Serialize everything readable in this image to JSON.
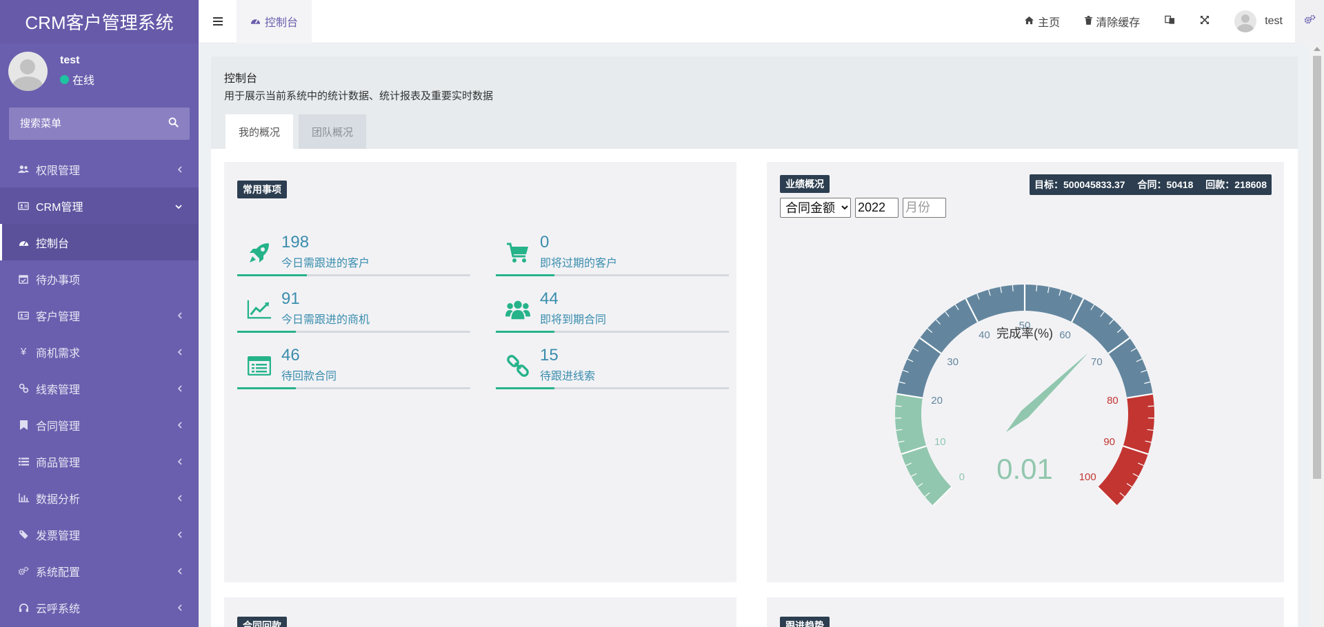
{
  "app": {
    "title": "CRM客户管理系统"
  },
  "user": {
    "name": "test",
    "status": "在线"
  },
  "search": {
    "placeholder": "搜索菜单"
  },
  "sidebar": {
    "items": [
      {
        "label": "权限管理",
        "icon": "users-icon",
        "state": "collapsed"
      },
      {
        "label": "CRM管理",
        "icon": "id-card-icon",
        "state": "expanded"
      },
      {
        "label": "控制台",
        "icon": "dashboard-icon",
        "state": "active"
      },
      {
        "label": "待办事项",
        "icon": "calendar-check-icon",
        "state": "plain"
      },
      {
        "label": "客户管理",
        "icon": "id-card-icon",
        "state": "collapsed"
      },
      {
        "label": "商机需求",
        "icon": "yen-icon",
        "state": "collapsed"
      },
      {
        "label": "线索管理",
        "icon": "link-icon",
        "state": "collapsed"
      },
      {
        "label": "合同管理",
        "icon": "bookmark-icon",
        "state": "collapsed"
      },
      {
        "label": "商品管理",
        "icon": "list-icon",
        "state": "collapsed"
      },
      {
        "label": "数据分析",
        "icon": "bar-chart-icon",
        "state": "collapsed"
      },
      {
        "label": "发票管理",
        "icon": "ticket-icon",
        "state": "collapsed"
      },
      {
        "label": "系统配置",
        "icon": "cogs-icon",
        "state": "collapsed"
      },
      {
        "label": "云呼系统",
        "icon": "headset-icon",
        "state": "collapsed"
      }
    ]
  },
  "topbar": {
    "tab": "控制台",
    "home": "主页",
    "clear_cache": "清除缓存",
    "user": "test"
  },
  "page": {
    "title": "控制台",
    "subtitle": "用于展示当前系统中的统计数据、统计报表及重要实时数据",
    "tabs": [
      "我的概况",
      "团队概况"
    ]
  },
  "common": {
    "title": "常用事项",
    "stats": [
      {
        "value": "198",
        "label": "今日需跟进的客户",
        "icon": "rocket-icon",
        "progress": 0.3
      },
      {
        "value": "0",
        "label": "即将过期的客户",
        "icon": "cart-icon",
        "progress": 0.25
      },
      {
        "value": "91",
        "label": "今日需跟进的商机",
        "icon": "trend-line-icon",
        "progress": 0.25
      },
      {
        "value": "44",
        "label": "即将到期合同",
        "icon": "users-group-icon",
        "progress": 0.25
      },
      {
        "value": "46",
        "label": "待回款合同",
        "icon": "list-alt-icon",
        "progress": 0.25
      },
      {
        "value": "15",
        "label": "待跟进线索",
        "icon": "chain-icon",
        "progress": 0.25
      }
    ]
  },
  "performance": {
    "title": "业绩概况",
    "target": "目标：500045833.37",
    "contract": "合同：50418",
    "payment": "回款：218608",
    "filter_type": "合同金额",
    "filter_year": "2022",
    "filter_month_placeholder": "月份",
    "gauge": {
      "title": "完成率(%)",
      "value": 0.01,
      "value_label": "0.01",
      "min": 0,
      "max": 100,
      "ticks": [
        "0",
        "10",
        "20",
        "30",
        "40",
        "50",
        "60",
        "70",
        "80",
        "90",
        "100"
      ],
      "colors": {
        "low": "#91c7ae",
        "mid": "#63869e",
        "high": "#c23531"
      }
    }
  },
  "bottom": {
    "left_title": "合同回款",
    "right_title": "跟进趋势"
  }
}
